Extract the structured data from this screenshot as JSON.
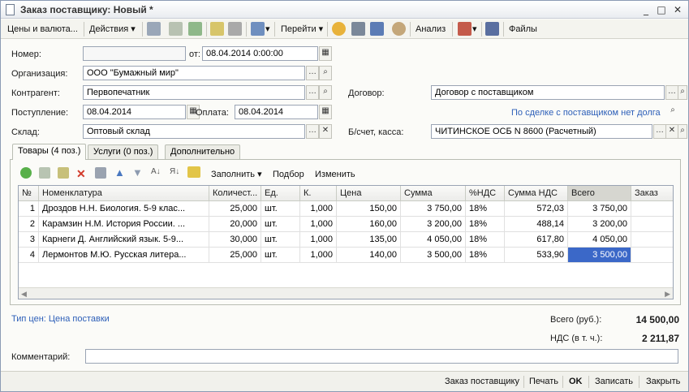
{
  "window": {
    "title": "Заказ поставщику: Новый *"
  },
  "toolbar": {
    "prices": "Цены и валюта...",
    "actions": "Действия",
    "goto": "Перейти",
    "analysis": "Анализ",
    "files": "Файлы"
  },
  "form": {
    "number_label": "Номер:",
    "number_value": "",
    "from_label": "от:",
    "from_value": "08.04.2014  0:00:00",
    "org_label": "Организация:",
    "org_value": "ООО \"Бумажный мир\"",
    "contractor_label": "Контрагент:",
    "contractor_value": "Первопечатник",
    "contract_label": "Договор:",
    "contract_value": "Договор с поставщиком",
    "receipt_label": "Поступление:",
    "receipt_value": "08.04.2014",
    "payment_label": "Оплата:",
    "payment_value": "08.04.2014",
    "debt_link": "По сделке с поставщиком нет долга",
    "warehouse_label": "Склад:",
    "warehouse_value": "Оптовый склад",
    "account_label": "Б/счет, касса:",
    "account_value": "ЧИТИНСКОЕ ОСБ N 8600 (Расчетный)"
  },
  "tabs": [
    "Товары (4 поз.)",
    "Услуги (0 поз.)",
    "Дополнительно"
  ],
  "grid_toolbar": {
    "fill": "Заполнить",
    "select": "Подбор",
    "change": "Изменить"
  },
  "table": {
    "columns": [
      "№",
      "Номенклатура",
      "Количест...",
      "Ед.",
      "К.",
      "Цена",
      "Сумма",
      "%НДС",
      "Сумма НДС",
      "Всего",
      "Заказ"
    ],
    "rows": [
      [
        "1",
        "Дроздов Н.Н. Биология. 5-9 клас...",
        "25,000",
        "шт.",
        "1,000",
        "150,00",
        "3 750,00",
        "18%",
        "572,03",
        "3 750,00",
        ""
      ],
      [
        "2",
        "Карамзин Н.М. История России. ...",
        "20,000",
        "шт.",
        "1,000",
        "160,00",
        "3 200,00",
        "18%",
        "488,14",
        "3 200,00",
        ""
      ],
      [
        "3",
        "Карнеги Д. Английский язык. 5-9...",
        "30,000",
        "шт.",
        "1,000",
        "135,00",
        "4 050,00",
        "18%",
        "617,80",
        "4 050,00",
        ""
      ],
      [
        "4",
        "Лермонтов М.Ю. Русская литера...",
        "25,000",
        "шт.",
        "1,000",
        "140,00",
        "3 500,00",
        "18%",
        "533,90",
        "3 500,00",
        ""
      ]
    ]
  },
  "summary": {
    "price_type": "Тип цен: Цена поставки",
    "total_label": "Всего (руб.):",
    "total_value": "14 500,00",
    "vat_label": "НДС (в т. ч.):",
    "vat_value": "2 211,87"
  },
  "comment": {
    "label": "Комментарий:",
    "value": ""
  },
  "footer": {
    "order": "Заказ поставщику",
    "print": "Печать",
    "ok": "OK",
    "save": "Записать",
    "close": "Закрыть"
  }
}
